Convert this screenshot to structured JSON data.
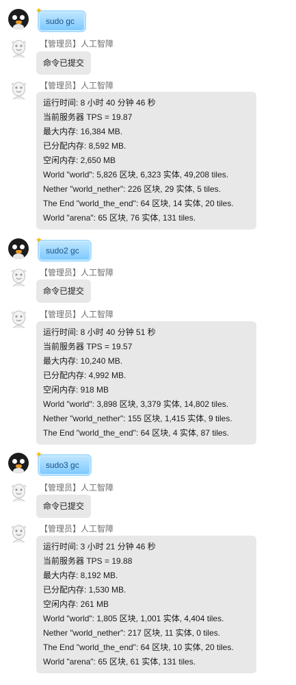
{
  "conversation": [
    {
      "command": "sudo gc",
      "ack_sender": "【管理员】人工智障",
      "ack_text": "命令已提交",
      "report_sender": "【管理员】人工智障",
      "report_lines": [
        "运行时间: 8 小时 40 分钟 46 秒",
        "当前服务器 TPS = 19.87",
        "最大内存: 16,384 MB.",
        "已分配内存: 8,592 MB.",
        "空闲内存: 2,650 MB",
        "World \"world\": 5,826 区块, 6,323 实体, 49,208 tiles.",
        "Nether \"world_nether\": 226 区块, 29 实体, 5 tiles.",
        "The End \"world_the_end\": 64 区块, 14 实体, 20 tiles.",
        "World \"arena\": 65 区块, 76 实体, 131 tiles."
      ]
    },
    {
      "command": "sudo2 gc",
      "ack_sender": "【管理员】人工智障",
      "ack_text": "命令已提交",
      "report_sender": "【管理员】人工智障",
      "report_lines": [
        "运行时间: 8 小时 40 分钟 51 秒",
        "当前服务器 TPS = 19.57",
        "最大内存: 10,240 MB.",
        "已分配内存: 4,992 MB.",
        "空闲内存: 918 MB",
        "World \"world\": 3,898 区块, 3,379 实体, 14,802 tiles.",
        "Nether \"world_nether\": 155 区块, 1,415 实体, 9 tiles.",
        "The End \"world_the_end\": 64 区块, 4 实体, 87 tiles."
      ]
    },
    {
      "command": "sudo3 gc",
      "ack_sender": "【管理员】人工智障",
      "ack_text": "命令已提交",
      "report_sender": "【管理员】人工智障",
      "report_lines": [
        "运行时间: 3 小时 21 分钟 46 秒",
        "当前服务器 TPS = 19.88",
        "最大内存: 8,192 MB.",
        "已分配内存: 1,530 MB.",
        "空闲内存: 261 MB",
        "World \"world\": 1,805 区块, 1,001 实体, 4,404 tiles.",
        "Nether \"world_nether\": 217 区块, 11 实体, 0 tiles.",
        "The End \"world_the_end\": 64 区块, 10 实体, 20 tiles.",
        "World \"arena\": 65 区块, 61 实体, 131 tiles."
      ]
    }
  ],
  "icons": {
    "user_avatar": "penguin-avatar-icon",
    "bot_avatar": "bot-avatar-icon",
    "badge": "star-badge-icon"
  },
  "colors": {
    "command_bubble": "#7cc8ff",
    "message_bubble": "#e8e8e8",
    "sender_text": "#6d6d6d"
  }
}
